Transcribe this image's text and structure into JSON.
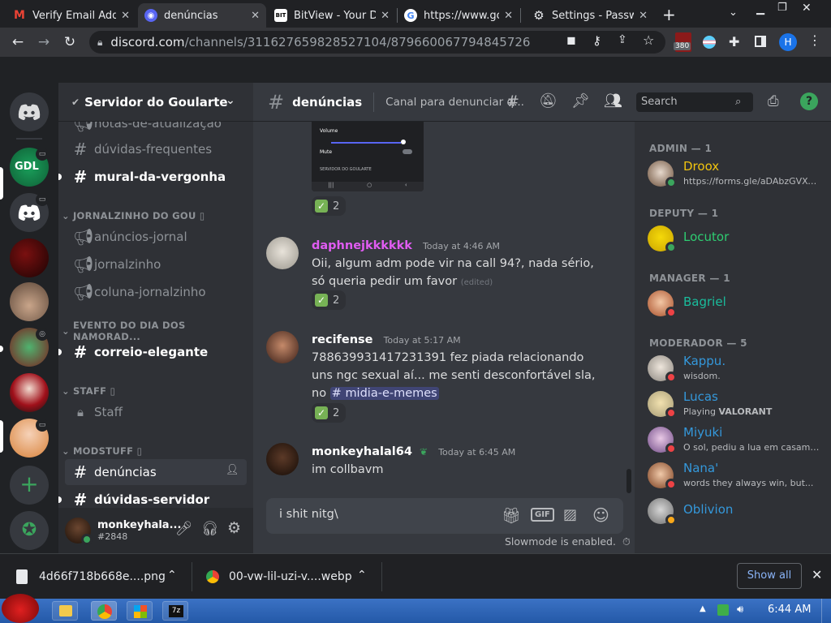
{
  "browser": {
    "tabs": [
      {
        "title": "Verify Email Add",
        "icon": "gmail-icon"
      },
      {
        "title": "denúncias",
        "icon": "discord-tab-icon"
      },
      {
        "title": "BitView - Your D",
        "icon": "bitview-icon"
      },
      {
        "title": "https://www.goo",
        "icon": "google-icon"
      },
      {
        "title": "Settings - Passw",
        "icon": "settings-gear-icon"
      }
    ],
    "url_domain": "discord.com",
    "url_path": "/channels/311627659828527104/879660067794845726",
    "extension_badge": "380",
    "profile_letter": "H"
  },
  "server": {
    "name": "Servidor do Goularte"
  },
  "channels": {
    "top": [
      {
        "name": "notas-de-atualização",
        "type": "announce",
        "state": "partial"
      },
      {
        "name": "dúvidas-frequentes",
        "type": "text",
        "state": "normal"
      },
      {
        "name": "mural-da-vergonha",
        "type": "text",
        "state": "unread"
      }
    ],
    "cat1": "JORNALZINHO DO GOU ▯",
    "cat1_items": [
      {
        "name": "anúncios-jornal",
        "type": "announce"
      },
      {
        "name": "jornalzinho",
        "type": "announce"
      },
      {
        "name": "coluna-jornalzinho",
        "type": "announce"
      }
    ],
    "cat2": "EVENTO DO DIA DOS NAMORAD...",
    "cat2_items": [
      {
        "name": "correio-elegante",
        "type": "text",
        "state": "unread"
      }
    ],
    "cat3": "STAFF ▯",
    "cat3_items": [
      {
        "name": "Staff",
        "type": "locked"
      }
    ],
    "cat4": "MODSTUFF ▯",
    "cat4_items": [
      {
        "name": "denúncias",
        "type": "text",
        "state": "selected"
      },
      {
        "name": "dúvidas-servidor",
        "type": "text",
        "state": "unread"
      }
    ]
  },
  "user": {
    "name": "monkeyhala...",
    "tag": "#2848"
  },
  "chat": {
    "channel_name": "denúncias",
    "topic": "Canal para denunciar q...",
    "search_placeholder": "Search",
    "image_preview": {
      "volume_label": "Volume",
      "mute_label": "Mute",
      "server_label": "SERVIDOR DO GOULARTE"
    },
    "image_reaction_count": "2",
    "messages": [
      {
        "author": "daphnejkkkkkk",
        "author_color": "#e05cf2",
        "time": "Today at 4:46 AM",
        "text": "Oii, algum adm pode vir na call 94?, nada sério, só queria pedir um favor",
        "edited": "(edited)",
        "reaction_count": "2"
      },
      {
        "author": "recifense",
        "author_color": "#ffffff",
        "time": "Today at 5:17 AM",
        "text": "788639931417231391 fez piada relacionando uns ngc sexual aí... me senti desconfortável sla, no",
        "mention": "midia-e-memes",
        "reaction_count": "2"
      },
      {
        "author": "monkeyhalal64",
        "author_color": "#ffffff",
        "time": "Today at 6:45 AM",
        "text": "im collbavm"
      }
    ],
    "composer_value": "i shit nitg\\",
    "slowmode_text": "Slowmode is enabled."
  },
  "members": {
    "groups": [
      {
        "label": "ADMIN — 1",
        "members": [
          {
            "name": "Droox",
            "color": "#f1c40f",
            "sub": "https://forms.gle/aDAbzGVXe...",
            "status": "#3ba55d"
          }
        ]
      },
      {
        "label": "DEPUTY — 1",
        "members": [
          {
            "name": "Locutor",
            "color": "#2ecc71",
            "sub": "",
            "status": "#3ba55d"
          }
        ]
      },
      {
        "label": "MANAGER — 1",
        "members": [
          {
            "name": "Bagriel",
            "color": "#1abc9c",
            "sub": "",
            "status": "#ed4245"
          }
        ]
      },
      {
        "label": "MODERADOR — 5",
        "members": [
          {
            "name": "Kappu.",
            "color": "#3498db",
            "sub": "wisdom.",
            "status": "#ed4245"
          },
          {
            "name": "Lucas",
            "color": "#3498db",
            "sub_prefix": "Playing ",
            "sub_bold": "VALORANT",
            "sub": "",
            "status": "#ed4245"
          },
          {
            "name": "Miyuki",
            "color": "#3498db",
            "sub": "O sol, pediu a lua em casamen...",
            "status": "#ed4245"
          },
          {
            "name": "Nana'",
            "color": "#3498db",
            "sub": "words they always win, but...",
            "status": "#ed4245"
          },
          {
            "name": "Oblivion",
            "color": "#3498db",
            "sub": "",
            "status": "#faa81a"
          }
        ]
      }
    ]
  },
  "downloads": {
    "file1": "4d66f718b668e....png",
    "file2": "00-vw-lil-uzi-v....webp",
    "show_all": "Show all"
  },
  "taskbar": {
    "time": "6:44 AM"
  }
}
